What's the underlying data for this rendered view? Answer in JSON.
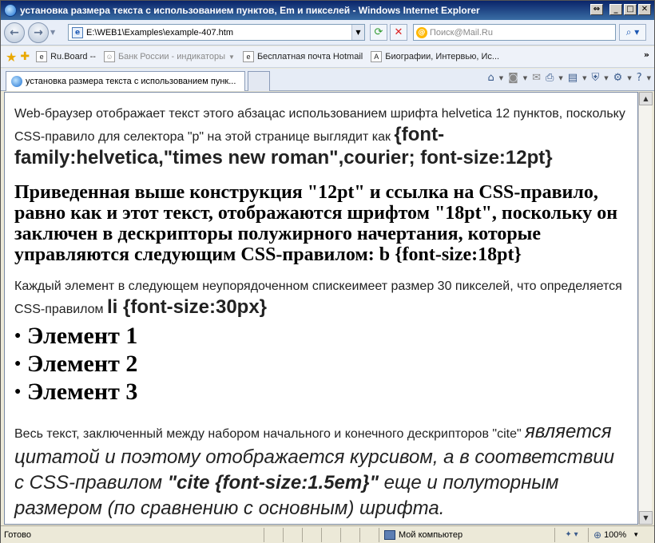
{
  "window": {
    "title": "установка размера текста с использованием пунктов, Em и пикселей - Windows Internet Explorer"
  },
  "address": {
    "url": "E:\\WEB1\\Examples\\example-407.htm",
    "search_placeholder": "Поиск@Mail.Ru"
  },
  "favorites": {
    "items": [
      {
        "label": "Ru.Board --",
        "dim": false
      },
      {
        "label": "Банк России - индикаторы",
        "dim": true
      },
      {
        "label": "Бесплатная почта Hotmail",
        "dim": false
      },
      {
        "label": "Биографии, Интервью, Ис...",
        "dim": false
      }
    ]
  },
  "tab": {
    "label": "установка размера текста с использованием пунк..."
  },
  "page": {
    "p1_text": "Web-браузер отображает текст этого абзацас использованием шрифта helvetica 12 пунктов, поскольку CSS-правило для селектора \"p\" на этой странице выглядит как ",
    "p1_bold": "{font-family:helvetica,\"times new roman\",courier; font-size:12pt}",
    "p2_text": "Приведенная выше конструкция \"12pt\" и ссылка на CSS-правило, равно как и этот текст, отображаются шрифтом \"18pt\", поскольку он заключен в дескрипторы полужирного начертания, которые управляются следующим CSS-правилом: b {font-size:18pt}",
    "p3_text": "Каждый элемент в следующем неупорядоченном спискеимеет размер 30 пикселей, что определяется CSS-правилом ",
    "p3_bold": "li {font-size:30px}",
    "list": [
      "Элемент 1",
      "Элемент 2",
      "Элемент 3"
    ],
    "p4_text": "Весь текст, заключенный между набором начального и конечного дескрипторов \"cite\" ",
    "p4_cite_a": "является цитатой и поэтому отображается курсивом, а в соответствии с CSS-правилом ",
    "p4_cite_bold": "\"cite {font-size:1.5em}\"",
    "p4_cite_b": " еще и полуторным размером (по сравнению с основным) шрифта."
  },
  "status": {
    "text": "Готово",
    "zone": "Мой компьютер",
    "zoom": "100%"
  },
  "icons": [
    "ie-icon",
    "back-icon",
    "forward-icon",
    "page-icon",
    "refresh-icon",
    "stop-icon",
    "mailru-icon",
    "search-icon",
    "favorites-star-icon",
    "add-favorite-icon",
    "home-icon",
    "rss-icon",
    "mail-icon",
    "print-icon",
    "page-menu-icon",
    "safety-icon",
    "tools-icon",
    "help-icon",
    "computer-icon",
    "zoom-icon"
  ]
}
